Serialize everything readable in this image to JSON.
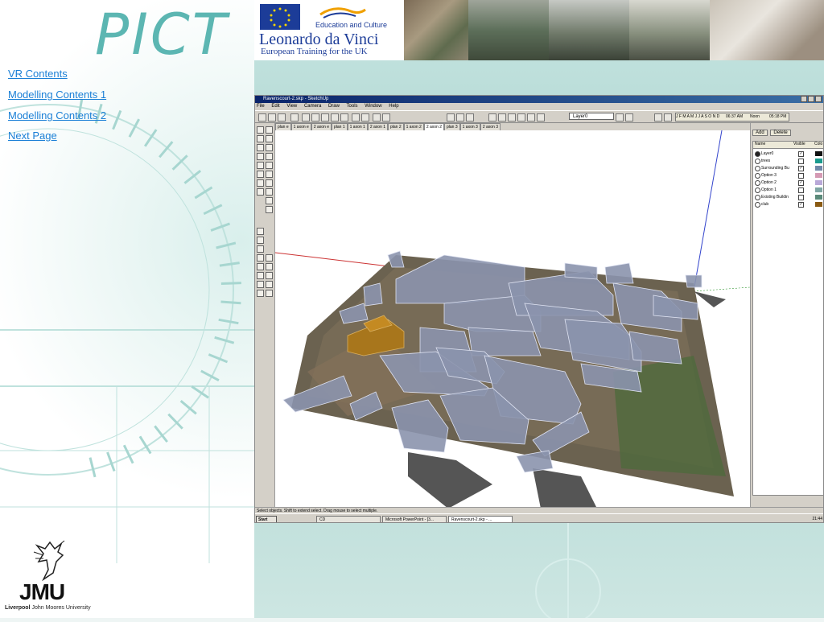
{
  "pict_logo": "PICT",
  "nav": {
    "links": [
      "VR Contents",
      "Modelling Contents 1",
      "Modelling Contents 2",
      "Next Page"
    ]
  },
  "banner": {
    "edu_text": "Education and Culture",
    "leonardo": "Leonardo da Vinci",
    "training": "European Training for the UK"
  },
  "jmu": {
    "mark": "JMU",
    "city": "Liverpool",
    "university": "John Moores University"
  },
  "sketchup": {
    "title": "Ravenscourt-2.skp - SketchUp",
    "menu": [
      "File",
      "Edit",
      "View",
      "Camera",
      "Draw",
      "Tools",
      "Window",
      "Help"
    ],
    "layer_select": "Layer0",
    "months": "J F M A M J J A S O N D",
    "time_left": "06:37 AM",
    "noon": "Noon",
    "time_right": "05:18 PM",
    "scene_tabs": [
      "plan e",
      "1 axon e",
      "2 axon e",
      "plan 1",
      "1 axon 1",
      "2 axon 1",
      "plan 2",
      "1 axon 2",
      "2 axon 2",
      "plan 3",
      "1 axon 3",
      "2 axon 3"
    ],
    "active_scene": "2 axon 2",
    "layers_panel": {
      "add": "Add",
      "delete": "Delete",
      "col_name": "Name",
      "col_visible": "Visible",
      "col_color": "Colo",
      "rows": [
        {
          "name": "Layer0",
          "visible": true,
          "color": "#111111",
          "active": true
        },
        {
          "name": "trees",
          "visible": false,
          "color": "#1a9b8e",
          "active": false
        },
        {
          "name": "Surrounding Bu",
          "visible": true,
          "color": "#6f88a8",
          "active": false
        },
        {
          "name": "Option 3",
          "visible": false,
          "color": "#d59ab4",
          "active": false
        },
        {
          "name": "Option 2",
          "visible": true,
          "color": "#b9a8d8",
          "active": false
        },
        {
          "name": "Option 1",
          "visible": false,
          "color": "#7fa6a4",
          "active": false
        },
        {
          "name": "Existing Buildin",
          "visible": false,
          "color": "#5b8a7a",
          "active": false
        },
        {
          "name": "club",
          "visible": true,
          "color": "#8a5a12",
          "active": false
        }
      ]
    },
    "status_text": "Select objects. Shift to extend select. Drag mouse to select multiple.",
    "taskbar": {
      "start": "Start",
      "tasks": [
        "CD",
        "Microsoft PowerPoint - [3...",
        "Ravenscourt-2.skp - ..."
      ],
      "clock": "21:44"
    }
  }
}
